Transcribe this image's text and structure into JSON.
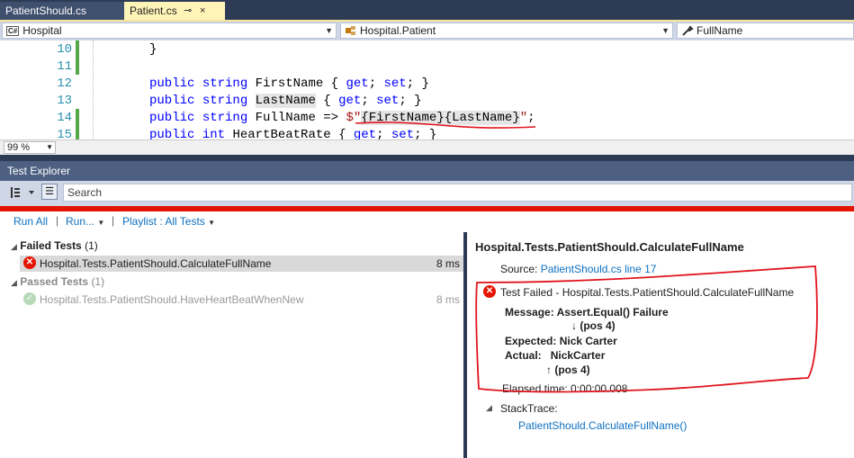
{
  "tabs": [
    {
      "label": "PatientShould.cs",
      "active": false
    },
    {
      "label": "Patient.cs",
      "active": true,
      "pin": "⊸",
      "close": "×"
    }
  ],
  "navbar": {
    "project": "Hospital",
    "project_badge": "C#",
    "type": "Hospital.Patient",
    "member": "FullName"
  },
  "editor": {
    "line_numbers": [
      "10",
      "11",
      "12",
      "13",
      "14",
      "15"
    ],
    "lines": [
      {
        "indent": "",
        "parts": [
          {
            "t": "}",
            "c": ""
          }
        ]
      },
      {
        "indent": "",
        "parts": []
      },
      {
        "indent": "",
        "parts": [
          {
            "t": "public",
            "c": "kw"
          },
          {
            "t": " ",
            "c": ""
          },
          {
            "t": "string",
            "c": "kw"
          },
          {
            "t": " FirstName { ",
            "c": ""
          },
          {
            "t": "get",
            "c": "kw"
          },
          {
            "t": "; ",
            "c": ""
          },
          {
            "t": "set",
            "c": "kw"
          },
          {
            "t": "; }",
            "c": ""
          }
        ]
      },
      {
        "indent": "",
        "parts": [
          {
            "t": "public",
            "c": "kw"
          },
          {
            "t": " ",
            "c": ""
          },
          {
            "t": "string",
            "c": "kw"
          },
          {
            "t": " ",
            "c": ""
          },
          {
            "t": "LastName",
            "c": "hl"
          },
          {
            "t": " { ",
            "c": ""
          },
          {
            "t": "get",
            "c": "kw"
          },
          {
            "t": "; ",
            "c": ""
          },
          {
            "t": "set",
            "c": "kw"
          },
          {
            "t": "; }",
            "c": ""
          }
        ]
      },
      {
        "indent": "",
        "parts": [
          {
            "t": "public",
            "c": "kw"
          },
          {
            "t": " ",
            "c": ""
          },
          {
            "t": "string",
            "c": "kw"
          },
          {
            "t": " FullName => ",
            "c": ""
          },
          {
            "t": "$\"",
            "c": "str"
          },
          {
            "t": "{",
            "c": "hl"
          },
          {
            "t": "FirstName",
            "c": "hl"
          },
          {
            "t": "}{",
            "c": "hl"
          },
          {
            "t": "LastName",
            "c": "hl"
          },
          {
            "t": "}",
            "c": "hl"
          },
          {
            "t": "\"",
            "c": "str"
          },
          {
            "t": ";",
            "c": ""
          }
        ]
      },
      {
        "indent": "",
        "parts": [
          {
            "t": "public",
            "c": "kw"
          },
          {
            "t": " ",
            "c": ""
          },
          {
            "t": "int",
            "c": "kw"
          },
          {
            "t": " HeartBeatRate { ",
            "c": ""
          },
          {
            "t": "get",
            "c": "kw"
          },
          {
            "t": "; ",
            "c": ""
          },
          {
            "t": "set",
            "c": "kw"
          },
          {
            "t": "; }",
            "c": ""
          }
        ]
      }
    ],
    "zoom": "99 %"
  },
  "test_explorer": {
    "title": "Test Explorer",
    "search_placeholder": "Search",
    "actions": {
      "run_all": "Run All",
      "run": "Run...",
      "playlist": "Playlist : All Tests"
    },
    "failed_group": {
      "label": "Failed Tests",
      "count": "(1)"
    },
    "passed_group": {
      "label": "Passed Tests",
      "count": "(1)"
    },
    "failed_tests": [
      {
        "name": "Hospital.Tests.PatientShould.CalculateFullName",
        "time": "8 ms"
      }
    ],
    "passed_tests": [
      {
        "name": "Hospital.Tests.PatientShould.HaveHeartBeatWhenNew",
        "time": "8 ms"
      }
    ],
    "detail": {
      "title": "Hospital.Tests.PatientShould.CalculateFullName",
      "source_label": "Source:",
      "source_link": "PatientShould.cs line 17",
      "fail_text": "Test Failed - Hospital.Tests.PatientShould.CalculateFullName",
      "message_label": "Message:",
      "message_value": "Assert.Equal() Failure",
      "pos1": "↓ (pos 4)",
      "expected_label": "Expected:",
      "expected_value": "Nick Carter",
      "actual_label": "Actual:",
      "actual_value": "NickCarter",
      "pos2": "↑ (pos 4)",
      "elapsed": "Elapsed time: 0:00:00.008",
      "stacktrace_label": "StackTrace:",
      "stacktrace_link": "PatientShould.CalculateFullName()"
    }
  },
  "colors": {
    "accent_blue": "#0e70c0",
    "fail_red": "#e51400",
    "annotation_red": "#e0141e",
    "active_tab": "#fff4b8"
  }
}
